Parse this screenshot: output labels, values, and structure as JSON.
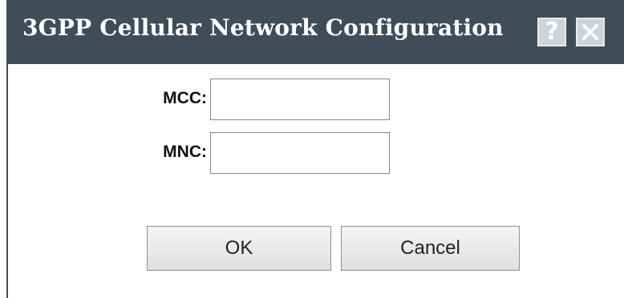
{
  "dialog": {
    "title": "3GPP Cellular Network Configuration",
    "help_symbol": "?",
    "close_icon": "close-icon",
    "help_icon": "help-icon"
  },
  "fields": {
    "mcc": {
      "label": "MCC:",
      "value": "",
      "placeholder": ""
    },
    "mnc": {
      "label": "MNC:",
      "value": "",
      "placeholder": ""
    }
  },
  "buttons": {
    "ok_label": "OK",
    "cancel_label": "Cancel"
  },
  "colors": {
    "titlebar": "#414c59",
    "title_text": "#ffffff",
    "title_button_bg": "#cfd3d8"
  }
}
